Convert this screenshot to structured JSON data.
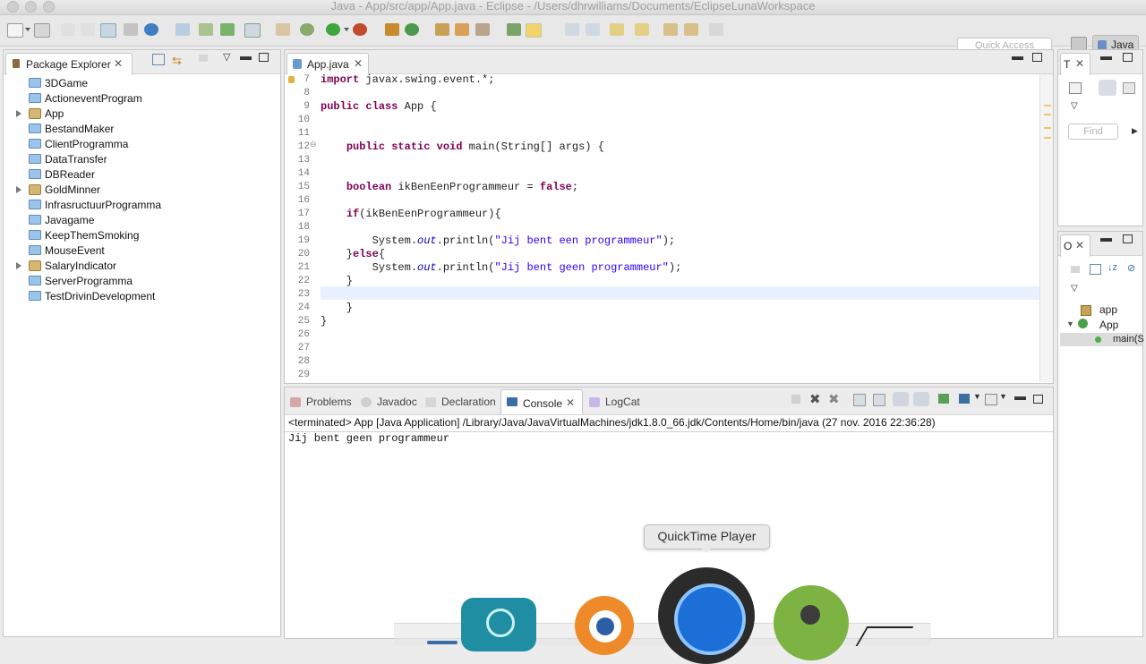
{
  "window": {
    "title": "Java - App/src/app/App.java - Eclipse - /Users/dhrwilliams/Documents/EclipseLunaWorkspace"
  },
  "toolbar": {
    "quick_access_placeholder": "Quick Access",
    "perspective_label": "Java"
  },
  "package_explorer": {
    "title": "Package Explorer",
    "items": [
      {
        "label": "3DGame",
        "kind": "folder"
      },
      {
        "label": "ActioneventProgram",
        "kind": "folder"
      },
      {
        "label": "App",
        "kind": "project"
      },
      {
        "label": "BestandMaker",
        "kind": "folder"
      },
      {
        "label": "ClientProgramma",
        "kind": "folder"
      },
      {
        "label": "DataTransfer",
        "kind": "folder"
      },
      {
        "label": "DBReader",
        "kind": "folder"
      },
      {
        "label": "GoldMinner",
        "kind": "project"
      },
      {
        "label": "InfrasructuurProgramma",
        "kind": "folder"
      },
      {
        "label": "Javagame",
        "kind": "folder"
      },
      {
        "label": "KeepThemSmoking",
        "kind": "folder"
      },
      {
        "label": "MouseEvent",
        "kind": "folder"
      },
      {
        "label": "SalaryIndicator",
        "kind": "project"
      },
      {
        "label": "ServerProgramma",
        "kind": "folder"
      },
      {
        "label": "TestDrivinDevelopment",
        "kind": "folder"
      }
    ]
  },
  "editor": {
    "tab_label": "App.java",
    "line_numbers": [
      "7",
      "8",
      "9",
      "10",
      "11",
      "12",
      "13",
      "14",
      "15",
      "16",
      "17",
      "18",
      "19",
      "20",
      "21",
      "22",
      "23",
      "24",
      "25",
      "26",
      "27",
      "28",
      "29"
    ],
    "lines": [
      "import javax.swing.event.*;",
      "",
      "public class App {",
      "",
      "",
      "    public static void main(String[] args) {",
      "",
      "",
      "    boolean ikBenEenProgrammeur = false;",
      "",
      "    if(ikBenEenProgrammeur){",
      "",
      "        System.out.println(\"Jij bent een programmeur\");",
      "    }else{",
      "        System.out.println(\"Jij bent geen programmeur\");",
      "    }",
      "",
      "    }",
      "}",
      "",
      "",
      "",
      ""
    ]
  },
  "task_list": {
    "tab_label": "T",
    "find_placeholder": "Find"
  },
  "outline": {
    "tab_label": "O",
    "items": [
      {
        "label": "app"
      },
      {
        "label": "App"
      },
      {
        "label": "main(S"
      }
    ]
  },
  "bottom_tabs": [
    {
      "label": "Problems"
    },
    {
      "label": "Javadoc"
    },
    {
      "label": "Declaration"
    },
    {
      "label": "Console"
    },
    {
      "label": "LogCat"
    }
  ],
  "console": {
    "status": "<terminated> App [Java Application] /Library/Java/JavaVirtualMachines/jdk1.8.0_66.jdk/Contents/Home/bin/java (27 nov. 2016 22:36:28)",
    "output": "Jij bent geen programmeur"
  },
  "dock": {
    "tooltip": "QuickTime Player"
  },
  "colors": {
    "keyword": "#7f0055",
    "string": "#2a00ff",
    "field": "#0000c0",
    "current_line": "#e8f2fe"
  }
}
